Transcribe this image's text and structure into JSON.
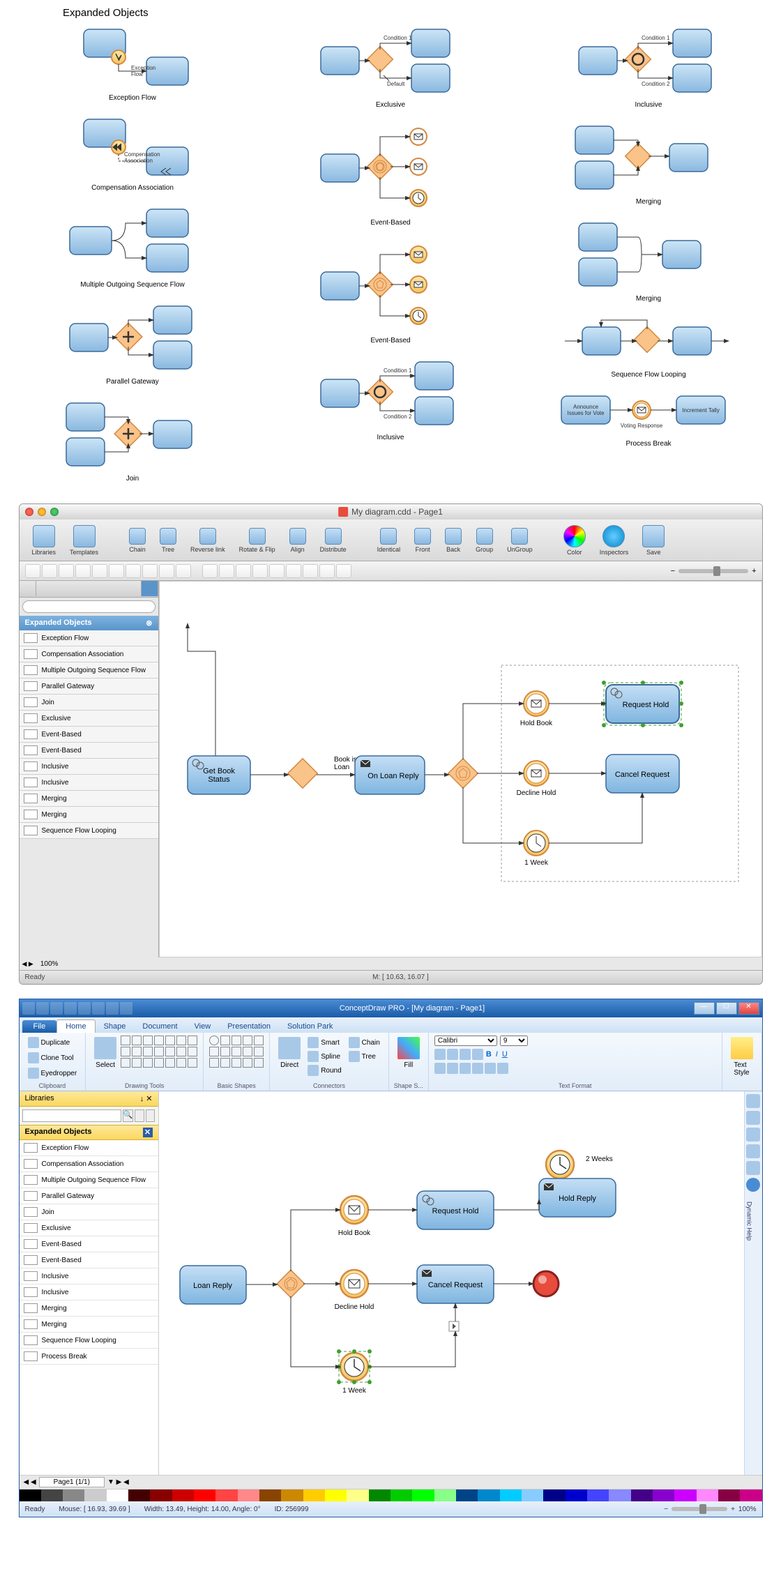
{
  "top": {
    "title": "Expanded Objects",
    "col1": [
      "Exception Flow",
      "Compensation Association",
      "Multiple Outgoing Sequence Flow",
      "Parallel Gateway",
      "Join"
    ],
    "col1_sub": {
      "exception": "Exception\nFlow",
      "comp": "Compensation\nAssociation"
    },
    "col2": [
      "Exclusive",
      "Event-Based",
      "Event-Based",
      "Inclusive"
    ],
    "col2_sub": {
      "cond1": "Condition 1",
      "default": "Default",
      "cond2": "Condition 2"
    },
    "col3": [
      "Inclusive",
      "Merging",
      "Merging",
      "Sequence Flow Looping",
      "Process Break"
    ],
    "col3_sub": {
      "cond1": "Condition 1",
      "cond2": "Condition 2",
      "announce": "Announce\nIssues for Vote",
      "voting": "Voting Response",
      "tally": "Increment Tally"
    }
  },
  "mac": {
    "title": "My diagram.cdd - Page1",
    "toolbar": [
      "Libraries",
      "Templates",
      "Chain",
      "Tree",
      "Reverse link",
      "Rotate & Flip",
      "Align",
      "Distribute",
      "Identical",
      "Front",
      "Back",
      "Group",
      "UnGroup",
      "Color",
      "Inspectors",
      "Save"
    ],
    "sidebar_title": "Expanded Objects",
    "sidebar_items": [
      "Exception Flow",
      "Compensation Association",
      "Multiple Outgoing Sequence Flow",
      "Parallel Gateway",
      "Join",
      "Exclusive",
      "Event-Based",
      "Event-Based",
      "Inclusive",
      "Inclusive",
      "Merging",
      "Merging",
      "Sequence Flow Looping"
    ],
    "canvas": {
      "get_book": "Get Book\nStatus",
      "book_is": "Book is\nLoan",
      "on_loan": "On Loan Reply",
      "hold_book": "Hold Book",
      "decline": "Decline Hold",
      "week": "1 Week",
      "req_hold": " Request Hold",
      "cancel": "Cancel Request"
    },
    "status_m": "M: [ 10.63, 16.07 ]",
    "status_ready": "Ready",
    "page_zoom": "100%"
  },
  "win": {
    "title": "ConceptDraw PRO - [My diagram - Page1]",
    "tabs": [
      "File",
      "Home",
      "Shape",
      "Document",
      "View",
      "Presentation",
      "Solution Park"
    ],
    "ribbon_groups": [
      "Clipboard",
      "Drawing Tools",
      "Basic Shapes",
      "Connectors",
      "Shape S...",
      "Text Format"
    ],
    "clipboard": [
      "Duplicate",
      "Clone Tool",
      "Eyedropper"
    ],
    "connectors": [
      "Direct",
      "Smart",
      "Spline",
      "Round",
      "Chain",
      "Tree"
    ],
    "fill": "Fill",
    "font": "Calibri",
    "fontsize": "9",
    "text_style": "Text\nStyle",
    "libraries": "Libraries",
    "sidebar_title": "Expanded Objects",
    "sidebar_items": [
      "Exception Flow",
      "Compensation Association",
      "Multiple Outgoing Sequence Flow",
      "Parallel Gateway",
      "Join",
      "Exclusive",
      "Event-Based",
      "Event-Based",
      "Inclusive",
      "Inclusive",
      "Merging",
      "Merging",
      "Sequence Flow Looping",
      "Process Break"
    ],
    "canvas": {
      "loan_reply": "Loan Reply",
      "hold_book": "Hold Book",
      "decline": "Decline Hold",
      "week": "1 Week",
      "req_hold": "Request Hold",
      "cancel": "Cancel Request",
      "weeks2": "2 Weeks",
      "hold_reply": "Hold Reply"
    },
    "page": "Page1 (1/1)",
    "status": {
      "ready": "Ready",
      "mouse": "Mouse: [ 16.93, 39.69 ]",
      "dims": "Width: 13.49,   Height: 14.00,   Angle: 0°",
      "id": "ID: 256999",
      "zoom": "100%"
    },
    "dynamic_help": "Dynamic Help"
  },
  "colors": [
    "#000",
    "#444",
    "#888",
    "#ccc",
    "#fff",
    "#400",
    "#800",
    "#c00",
    "#f00",
    "#f44",
    "#f88",
    "#840",
    "#c80",
    "#fc0",
    "#ff0",
    "#ff8",
    "#080",
    "#0c0",
    "#0f0",
    "#8f8",
    "#048",
    "#08c",
    "#0cf",
    "#8cf",
    "#008",
    "#00c",
    "#44f",
    "#88f",
    "#408",
    "#80c",
    "#c0f",
    "#f8f",
    "#804",
    "#c08"
  ]
}
